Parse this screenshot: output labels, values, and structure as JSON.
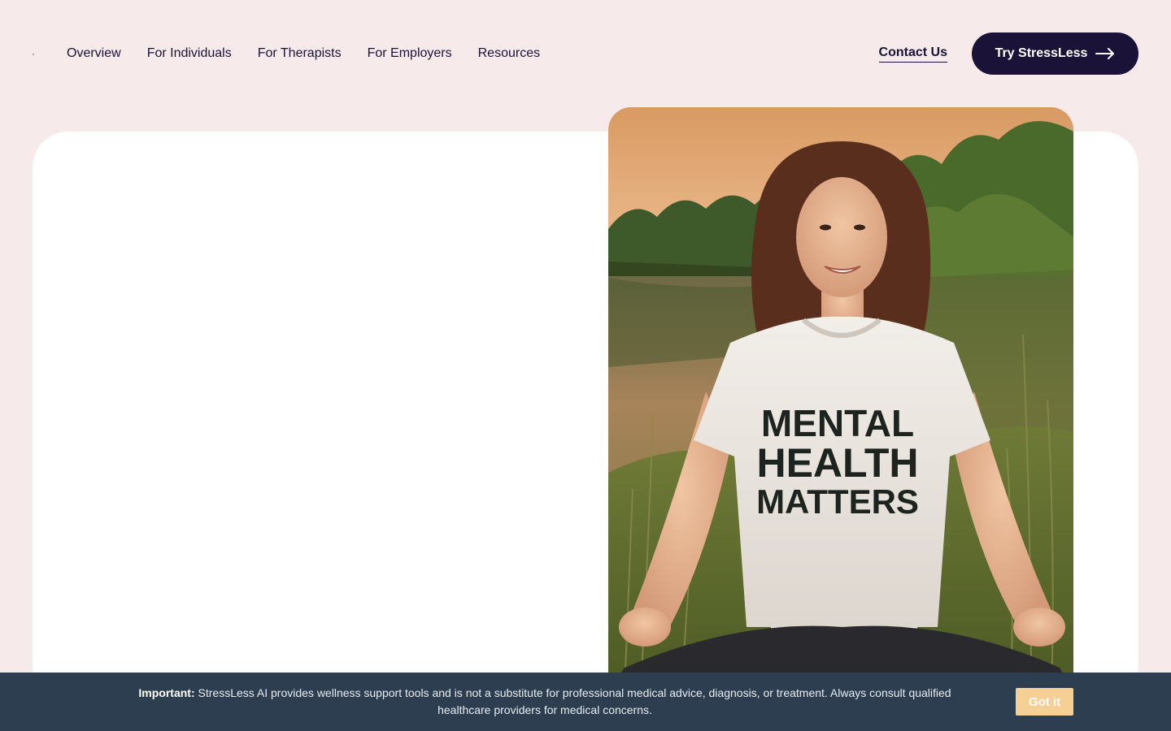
{
  "nav": {
    "links": [
      {
        "label": "Overview"
      },
      {
        "label": "For Individuals"
      },
      {
        "label": "For Therapists"
      },
      {
        "label": "For Employers"
      },
      {
        "label": "Resources"
      }
    ],
    "contact_label": "Contact Us",
    "cta_label": "Try StressLess",
    "cta_icon": "arrow-right-icon"
  },
  "hero": {
    "image_alt": "Woman meditating by a lake wearing a Mental Health Matters t-shirt",
    "shirt_text": [
      "MENTAL",
      "HEALTH",
      "MATTERS"
    ]
  },
  "notice": {
    "prefix": "Important:",
    "message": "StressLess AI provides wellness support tools and is not a substitute for professional medical advice, diagnosis, or treatment. Always consult qualified healthcare providers for medical concerns.",
    "button_label": "Got it"
  },
  "colors": {
    "background": "#f6ebea",
    "brand_dark": "#1b1238",
    "notice_bg": "#2d3e50",
    "notice_button": "#f6cf94"
  }
}
